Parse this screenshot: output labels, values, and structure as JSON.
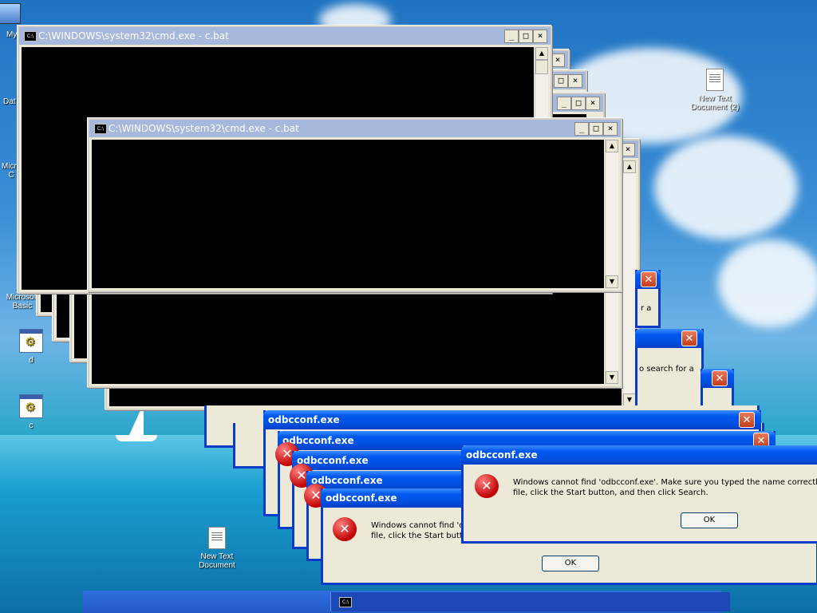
{
  "desktop": {
    "icons": [
      {
        "label": "My"
      },
      {
        "label": "Dat"
      },
      {
        "label": "Micro\nC"
      },
      {
        "label": "Microsoft\nBasic"
      },
      {
        "label": "d"
      },
      {
        "label": "c"
      },
      {
        "label": "New Text\nDocument (2)"
      },
      {
        "label": "New Text\nDocument"
      }
    ]
  },
  "cmd_windows": {
    "title": "C:\\WINDOWS\\system32\\cmd.exe - c.bat",
    "icon_text": "C:\\",
    "minimize": "_",
    "maximize": "□",
    "close": "×"
  },
  "dialogs": {
    "title": "odbcconf.exe",
    "message_front_line1": "Windows cannot find 'odbcconf.exe'. Make sure you typed the name correctly, a",
    "message_front_line2": "file, click the Start button, and then click Search.",
    "message_back_line1": "Windows cannot find 'oc",
    "message_back_line2": "file, click the Start butto",
    "partial_text_1": "r a",
    "partial_text_2": "o search for a",
    "partial_text_3": "",
    "ok_label": "OK",
    "close_glyph": "✕",
    "error_glyph": "✕"
  },
  "colors": {
    "xp_title_blue": "#0058ee",
    "cmd_inactive_title": "#a7b8dd",
    "error_red": "#c00000"
  },
  "taskbar": {
    "task_icon_text": "C:\\"
  }
}
